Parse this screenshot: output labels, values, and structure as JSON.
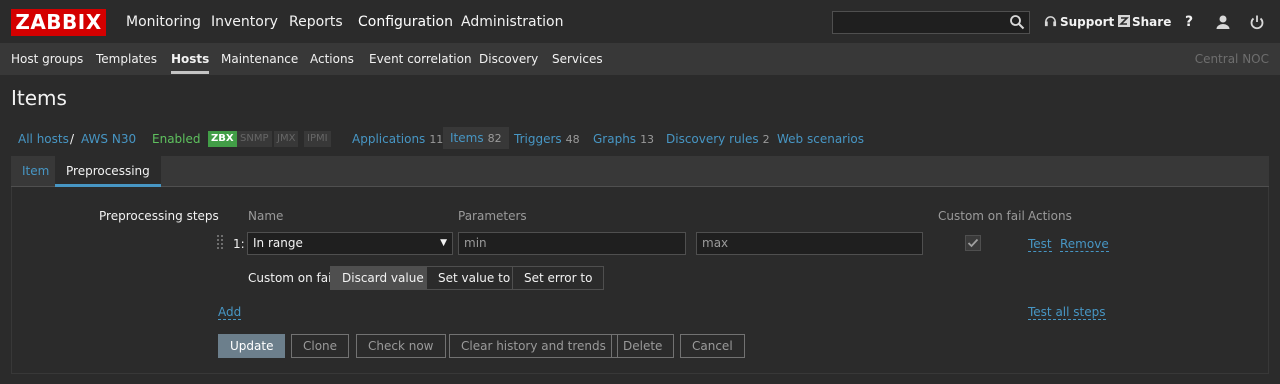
{
  "logo": "ZABBIX",
  "topnav": [
    "Monitoring",
    "Inventory",
    "Reports",
    "Configuration",
    "Administration"
  ],
  "topright": {
    "support": "Support",
    "share": "Share",
    "help": "?"
  },
  "subnav": [
    "Host groups",
    "Templates",
    "Hosts",
    "Maintenance",
    "Actions",
    "Event correlation",
    "Discovery",
    "Services"
  ],
  "server_name": "Central NOC",
  "page_title": "Items",
  "breadcrumbs": {
    "all_hosts": "All hosts",
    "sep": "/",
    "host": "AWS N30",
    "enabled": "Enabled",
    "availability": [
      "ZBX",
      "SNMP",
      "JMX",
      "IPMI"
    ],
    "applications": {
      "label": "Applications",
      "count": "11"
    },
    "items": {
      "label": "Items",
      "count": "82"
    },
    "triggers": {
      "label": "Triggers",
      "count": "48"
    },
    "graphs": {
      "label": "Graphs",
      "count": "13"
    },
    "discovery": {
      "label": "Discovery rules",
      "count": "2"
    },
    "web": {
      "label": "Web scenarios"
    }
  },
  "tabs": {
    "item": "Item",
    "preprocessing": "Preprocessing"
  },
  "form": {
    "steps_label": "Preprocessing steps",
    "col_name": "Name",
    "col_params": "Parameters",
    "col_custom": "Custom on fail",
    "col_actions": "Actions",
    "step_index": "1:",
    "step_type": "In range",
    "param_min_placeholder": "min",
    "param_max_placeholder": "max",
    "test_link": "Test",
    "remove_link": "Remove",
    "custom_on_fail_label": "Custom on fail",
    "fail_options": [
      "Discard value",
      "Set value to",
      "Set error to"
    ],
    "add_link": "Add",
    "test_all_link": "Test all steps"
  },
  "buttons": [
    "Update",
    "Clone",
    "Check now",
    "Clear history and trends",
    "Delete",
    "Cancel"
  ],
  "colors": {
    "brand_red": "#d40000",
    "link": "#4796c4",
    "enabled": "#5ec05e",
    "zbx_green": "#429e47"
  }
}
